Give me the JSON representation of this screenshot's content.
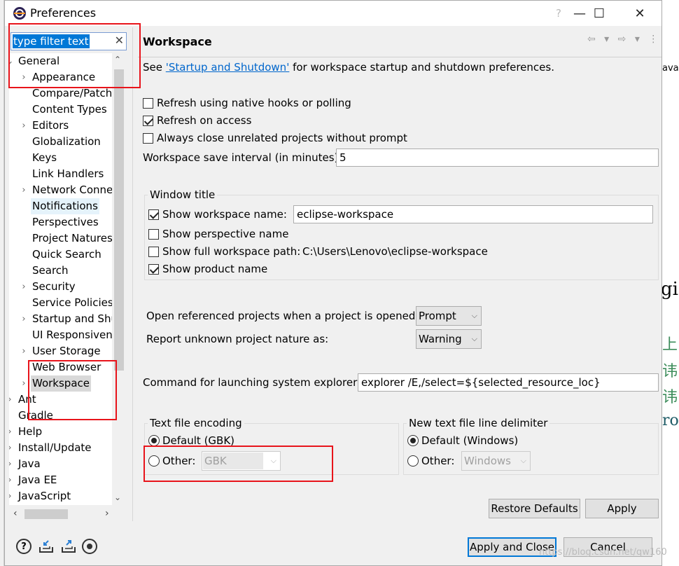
{
  "window": {
    "title": "Preferences",
    "help_label": "?",
    "minimize_label": "—",
    "maximize_label": "☐",
    "close_label": "✕"
  },
  "sidebar": {
    "filter_placeholder": "type filter text",
    "filter_value": "type filter text",
    "tree": [
      {
        "label": "General",
        "level": 0,
        "toggle": "⌄"
      },
      {
        "label": "Appearance",
        "level": 1,
        "toggle": "›"
      },
      {
        "label": "Compare/Patch",
        "level": 1,
        "toggle": ""
      },
      {
        "label": "Content Types",
        "level": 1,
        "toggle": ""
      },
      {
        "label": "Editors",
        "level": 1,
        "toggle": "›"
      },
      {
        "label": "Globalization",
        "level": 1,
        "toggle": ""
      },
      {
        "label": "Keys",
        "level": 1,
        "toggle": ""
      },
      {
        "label": "Link Handlers",
        "level": 1,
        "toggle": ""
      },
      {
        "label": "Network Connections",
        "level": 1,
        "toggle": "›"
      },
      {
        "label": "Notifications",
        "level": 1,
        "toggle": "",
        "state": "hover"
      },
      {
        "label": "Perspectives",
        "level": 1,
        "toggle": ""
      },
      {
        "label": "Project Natures",
        "level": 1,
        "toggle": ""
      },
      {
        "label": "Quick Search",
        "level": 1,
        "toggle": ""
      },
      {
        "label": "Search",
        "level": 1,
        "toggle": ""
      },
      {
        "label": "Security",
        "level": 1,
        "toggle": "›"
      },
      {
        "label": "Service Policies",
        "level": 1,
        "toggle": ""
      },
      {
        "label": "Startup and Shutdown",
        "level": 1,
        "toggle": "›"
      },
      {
        "label": "UI Responsiveness",
        "level": 1,
        "toggle": ""
      },
      {
        "label": "User Storage",
        "level": 1,
        "toggle": "›"
      },
      {
        "label": "Web Browser",
        "level": 1,
        "toggle": ""
      },
      {
        "label": "Workspace",
        "level": 1,
        "toggle": "›",
        "state": "selected"
      },
      {
        "label": "Ant",
        "level": 0,
        "toggle": "›"
      },
      {
        "label": "Gradle",
        "level": 0,
        "toggle": ""
      },
      {
        "label": "Help",
        "level": 0,
        "toggle": "›"
      },
      {
        "label": "Install/Update",
        "level": 0,
        "toggle": "›"
      },
      {
        "label": "Java",
        "level": 0,
        "toggle": "›"
      },
      {
        "label": "Java EE",
        "level": 0,
        "toggle": "›"
      },
      {
        "label": "JavaScript",
        "level": 0,
        "toggle": "›"
      }
    ]
  },
  "page": {
    "title": "Workspace",
    "nav_arrows": "⇦ ▾ ⇨ ▾ ⋮",
    "intro_prefix": "See ",
    "intro_link": "'Startup and Shutdown'",
    "intro_suffix": " for workspace startup and shutdown preferences.",
    "refresh_native_label": "Refresh using native hooks or polling",
    "refresh_native_checked": false,
    "refresh_access_label": "Refresh on access",
    "refresh_access_checked": true,
    "always_close_label": "Always close unrelated projects without prompt",
    "always_close_checked": false,
    "save_interval_label": "Workspace save interval (in minutes):",
    "save_interval_value": "5",
    "window_title_group": "Window title",
    "show_ws_name_label": "Show workspace name:",
    "show_ws_name_checked": true,
    "ws_name_value": "eclipse-workspace",
    "show_perspective_label": "Show perspective name",
    "show_perspective_checked": false,
    "show_full_path_label": "Show full workspace path:",
    "show_full_path_checked": false,
    "full_path_value": "C:\\Users\\Lenovo\\eclipse-workspace",
    "show_product_label": "Show product name",
    "show_product_checked": true,
    "open_ref_label": "Open referenced projects when a project is opened:",
    "open_ref_value": "Prompt",
    "report_unknown_label": "Report unknown project nature as:",
    "report_unknown_value": "Warning",
    "explorer_cmd_label": "Command for launching system explorer:",
    "explorer_cmd_value": "explorer /E,/select=${selected_resource_loc}",
    "encoding_group": "Text file encoding",
    "encoding_default_label": "Default (GBK)",
    "encoding_other_label": "Other:",
    "encoding_other_value": "GBK",
    "delimiter_group": "New text file line delimiter",
    "delimiter_default_label": "Default (Windows)",
    "delimiter_other_label": "Other:",
    "delimiter_other_value": "Windows",
    "restore_defaults_label": "Restore Defaults",
    "apply_label": "Apply"
  },
  "footer": {
    "apply_close_label": "Apply and Close",
    "cancel_label": "Cancel"
  },
  "background_fragments": [
    "ava",
    "gi",
    "上 ,",
    "讳 纟",
    "讳 纟",
    "roo"
  ],
  "watermark": "https://blog.csdn.net/qw160",
  "colors": {
    "annotation": "#e8141b",
    "selection": "#0078d7",
    "link": "#0066cc"
  }
}
